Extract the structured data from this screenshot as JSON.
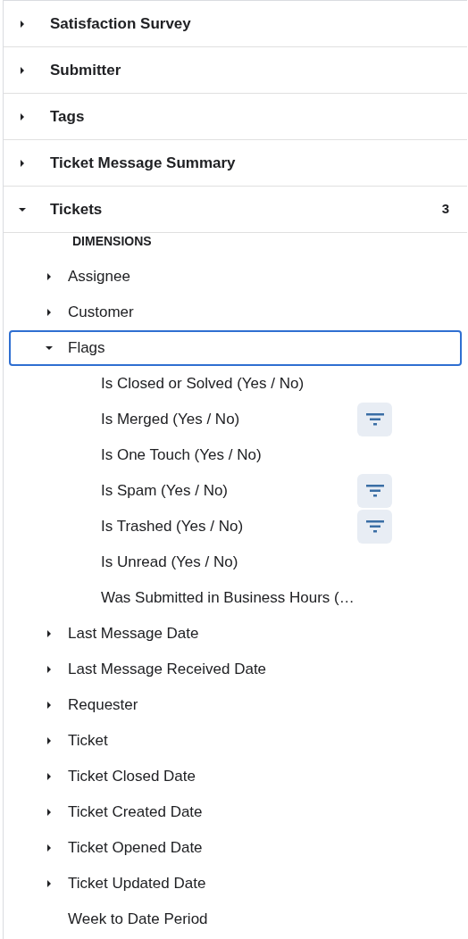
{
  "groups": [
    {
      "label": "Satisfaction Survey",
      "expanded": false
    },
    {
      "label": "Submitter",
      "expanded": false
    },
    {
      "label": "Tags",
      "expanded": false
    },
    {
      "label": "Ticket Message Summary",
      "expanded": false
    },
    {
      "label": "Tickets",
      "expanded": true,
      "count": "3",
      "section": "DIMENSIONS",
      "items": [
        {
          "kind": "folder",
          "label": "Assignee",
          "expanded": false,
          "selected": false
        },
        {
          "kind": "folder",
          "label": "Customer",
          "expanded": false,
          "selected": false
        },
        {
          "kind": "folder",
          "label": "Flags",
          "expanded": true,
          "selected": true,
          "children": [
            {
              "label": "Is Closed or Solved (Yes / No)",
              "filtered": false
            },
            {
              "label": "Is Merged (Yes / No)",
              "filtered": true
            },
            {
              "label": "Is One Touch (Yes / No)",
              "filtered": false
            },
            {
              "label": "Is Spam (Yes / No)",
              "filtered": true
            },
            {
              "label": "Is Trashed (Yes / No)",
              "filtered": true
            },
            {
              "label": "Is Unread (Yes / No)",
              "filtered": false
            },
            {
              "label": "Was Submitted in Business Hours (…",
              "filtered": false
            }
          ]
        },
        {
          "kind": "folder",
          "label": "Last Message Date",
          "expanded": false,
          "selected": false
        },
        {
          "kind": "folder",
          "label": "Last Message Received Date",
          "expanded": false,
          "selected": false
        },
        {
          "kind": "folder",
          "label": "Requester",
          "expanded": false,
          "selected": false
        },
        {
          "kind": "folder",
          "label": "Ticket",
          "expanded": false,
          "selected": false
        },
        {
          "kind": "folder",
          "label": "Ticket Closed Date",
          "expanded": false,
          "selected": false
        },
        {
          "kind": "folder",
          "label": "Ticket Created Date",
          "expanded": false,
          "selected": false
        },
        {
          "kind": "folder",
          "label": "Ticket Opened Date",
          "expanded": false,
          "selected": false
        },
        {
          "kind": "folder",
          "label": "Ticket Updated Date",
          "expanded": false,
          "selected": false
        },
        {
          "kind": "field",
          "label": "Week to Date Period",
          "selected": false
        }
      ]
    }
  ]
}
